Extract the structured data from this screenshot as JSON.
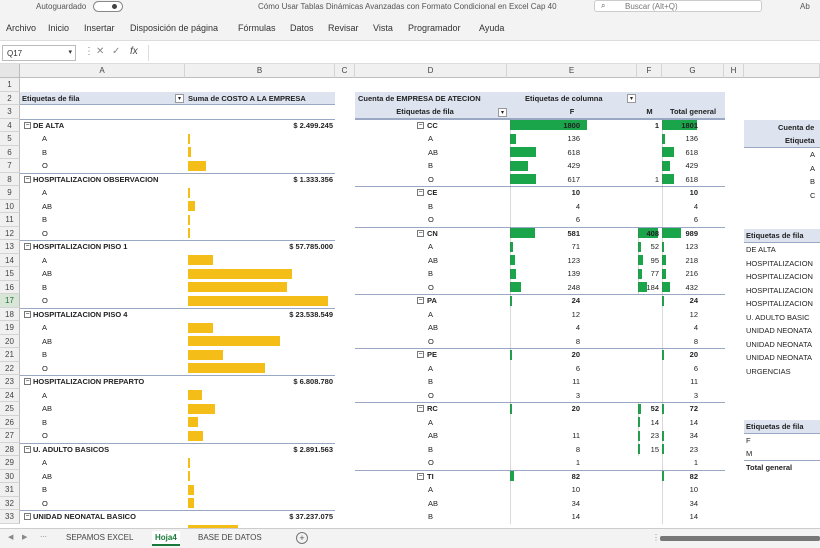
{
  "titlebar": {
    "autosave_label": "Autoguardado",
    "doc_title": "Cómo Usar Tablas Dinámicas Avanzadas con Formato Condicional en Excel Cap 40",
    "search_placeholder": "Buscar (Alt+Q)",
    "user": "Ab"
  },
  "menu": [
    "Archivo",
    "Inicio",
    "Insertar",
    "Disposición de página",
    "Fórmulas",
    "Datos",
    "Revisar",
    "Vista",
    "Programador",
    "Ayuda"
  ],
  "formula": {
    "namebox": "Q17",
    "fx": "fx",
    "content": ""
  },
  "columns": [
    "A",
    "B",
    "C",
    "D",
    "E",
    "F",
    "G",
    "H"
  ],
  "rows": [
    "1",
    "2",
    "3",
    "4",
    "5",
    "6",
    "7",
    "8",
    "9",
    "10",
    "11",
    "12",
    "13",
    "14",
    "15",
    "16",
    "17",
    "18",
    "19",
    "20",
    "21",
    "22",
    "23",
    "24",
    "25",
    "26",
    "27",
    "28",
    "29",
    "30",
    "31",
    "32",
    "33"
  ],
  "pivot1": {
    "header_rows": "Etiquetas de fila",
    "header_sum": "Suma de COSTO A LA EMPRESA",
    "rows": [
      {
        "label": "DE ALTA",
        "value": "$ 2.499.245",
        "group": true,
        "bar": 0
      },
      {
        "label": "A",
        "value": "",
        "group": false,
        "bar": 0.01
      },
      {
        "label": "B",
        "value": "",
        "group": false,
        "bar": 0.02
      },
      {
        "label": "O",
        "value": "",
        "group": false,
        "bar": 0.13
      },
      {
        "label": "HOSPITALIZACION OBSERVACION",
        "value": "$ 1.333.356",
        "group": true,
        "bar": 0
      },
      {
        "label": "A",
        "value": "",
        "group": false,
        "bar": 0.005
      },
      {
        "label": "AB",
        "value": "",
        "group": false,
        "bar": 0.05
      },
      {
        "label": "B",
        "value": "",
        "group": false,
        "bar": 0.005
      },
      {
        "label": "O",
        "value": "",
        "group": false,
        "bar": 0.005
      },
      {
        "label": "HOSPITALIZACION PISO 1",
        "value": "$ 57.785.000",
        "group": true,
        "bar": 0
      },
      {
        "label": "A",
        "value": "",
        "group": false,
        "bar": 0.18
      },
      {
        "label": "AB",
        "value": "",
        "group": false,
        "bar": 0.74
      },
      {
        "label": "B",
        "value": "",
        "group": false,
        "bar": 0.71
      },
      {
        "label": "O",
        "value": "",
        "group": false,
        "bar": 1.0
      },
      {
        "label": "HOSPITALIZACION PISO 4",
        "value": "$ 23.538.549",
        "group": true,
        "bar": 0
      },
      {
        "label": "A",
        "value": "",
        "group": false,
        "bar": 0.18
      },
      {
        "label": "AB",
        "value": "",
        "group": false,
        "bar": 0.66
      },
      {
        "label": "B",
        "value": "",
        "group": false,
        "bar": 0.25
      },
      {
        "label": "O",
        "value": "",
        "group": false,
        "bar": 0.55
      },
      {
        "label": "HOSPITALIZACION PREPARTO",
        "value": "$ 6.808.780",
        "group": true,
        "bar": 0
      },
      {
        "label": "A",
        "value": "",
        "group": false,
        "bar": 0.1
      },
      {
        "label": "AB",
        "value": "",
        "group": false,
        "bar": 0.19
      },
      {
        "label": "B",
        "value": "",
        "group": false,
        "bar": 0.07
      },
      {
        "label": "O",
        "value": "",
        "group": false,
        "bar": 0.11
      },
      {
        "label": "U. ADULTO BASICOS",
        "value": "$ 2.891.563",
        "group": true,
        "bar": 0
      },
      {
        "label": "A",
        "value": "",
        "group": false,
        "bar": 0.005
      },
      {
        "label": "AB",
        "value": "",
        "group": false,
        "bar": 0.005
      },
      {
        "label": "B",
        "value": "",
        "group": false,
        "bar": 0.04
      },
      {
        "label": "O",
        "value": "",
        "group": false,
        "bar": 0.04
      },
      {
        "label": "UNIDAD NEONATAL BASICO",
        "value": "$ 37.237.075",
        "group": true,
        "bar": 0
      },
      {
        "label": "A",
        "value": "",
        "group": false,
        "bar": 0.36
      }
    ]
  },
  "pivot2": {
    "title": "Cuenta de EMPRESA DE ATECION",
    "col_label": "Etiquetas de columna",
    "rows_label": "Etiquetas de fila",
    "col_f": "F",
    "col_m": "M",
    "col_total": "Total general",
    "rows": [
      {
        "label": "CC",
        "f": "1800",
        "m": "1",
        "t": "1801",
        "group": true,
        "fb": 1.0,
        "mb": 0,
        "tb": 1.0
      },
      {
        "label": "A",
        "f": "136",
        "m": "",
        "t": "136",
        "group": false,
        "fb": 0.08,
        "mb": 0,
        "tb": 0.08
      },
      {
        "label": "AB",
        "f": "618",
        "m": "",
        "t": "618",
        "group": false,
        "fb": 0.34,
        "mb": 0,
        "tb": 0.34
      },
      {
        "label": "B",
        "f": "429",
        "m": "",
        "t": "429",
        "group": false,
        "fb": 0.24,
        "mb": 0,
        "tb": 0.24
      },
      {
        "label": "O",
        "f": "617",
        "m": "1",
        "t": "618",
        "group": false,
        "fb": 0.34,
        "mb": 0,
        "tb": 0.34
      },
      {
        "label": "CE",
        "f": "10",
        "m": "",
        "t": "10",
        "group": true,
        "fb": 0,
        "mb": 0,
        "tb": 0
      },
      {
        "label": "B",
        "f": "4",
        "m": "",
        "t": "4",
        "group": false,
        "fb": 0,
        "mb": 0,
        "tb": 0
      },
      {
        "label": "O",
        "f": "6",
        "m": "",
        "t": "6",
        "group": false,
        "fb": 0,
        "mb": 0,
        "tb": 0
      },
      {
        "label": "CN",
        "f": "581",
        "m": "408",
        "t": "989",
        "group": true,
        "fb": 0.32,
        "mb": 1.0,
        "tb": 0.55
      },
      {
        "label": "A",
        "f": "71",
        "m": "52",
        "t": "123",
        "group": false,
        "fb": 0.04,
        "mb": 0.13,
        "tb": 0.07
      },
      {
        "label": "AB",
        "f": "123",
        "m": "95",
        "t": "218",
        "group": false,
        "fb": 0.07,
        "mb": 0.23,
        "tb": 0.12
      },
      {
        "label": "B",
        "f": "139",
        "m": "77",
        "t": "216",
        "group": false,
        "fb": 0.08,
        "mb": 0.19,
        "tb": 0.12
      },
      {
        "label": "O",
        "f": "248",
        "m": "184",
        "t": "432",
        "group": false,
        "fb": 0.14,
        "mb": 0.45,
        "tb": 0.24
      },
      {
        "label": "PA",
        "f": "24",
        "m": "",
        "t": "24",
        "group": true,
        "fb": 0.013,
        "mb": 0,
        "tb": 0.013
      },
      {
        "label": "A",
        "f": "12",
        "m": "",
        "t": "12",
        "group": false,
        "fb": 0,
        "mb": 0,
        "tb": 0
      },
      {
        "label": "AB",
        "f": "4",
        "m": "",
        "t": "4",
        "group": false,
        "fb": 0,
        "mb": 0,
        "tb": 0
      },
      {
        "label": "O",
        "f": "8",
        "m": "",
        "t": "8",
        "group": false,
        "fb": 0,
        "mb": 0,
        "tb": 0
      },
      {
        "label": "PE",
        "f": "20",
        "m": "",
        "t": "20",
        "group": true,
        "fb": 0.011,
        "mb": 0,
        "tb": 0.011
      },
      {
        "label": "A",
        "f": "6",
        "m": "",
        "t": "6",
        "group": false,
        "fb": 0,
        "mb": 0,
        "tb": 0
      },
      {
        "label": "B",
        "f": "11",
        "m": "",
        "t": "11",
        "group": false,
        "fb": 0,
        "mb": 0,
        "tb": 0
      },
      {
        "label": "O",
        "f": "3",
        "m": "",
        "t": "3",
        "group": false,
        "fb": 0,
        "mb": 0,
        "tb": 0
      },
      {
        "label": "RC",
        "f": "20",
        "m": "52",
        "t": "72",
        "group": true,
        "fb": 0.011,
        "mb": 0.13,
        "tb": 0.04
      },
      {
        "label": "A",
        "f": "",
        "m": "14",
        "t": "14",
        "group": false,
        "fb": 0,
        "mb": 0.03,
        "tb": 0
      },
      {
        "label": "AB",
        "f": "11",
        "m": "23",
        "t": "34",
        "group": false,
        "fb": 0,
        "mb": 0.05,
        "tb": 0.02
      },
      {
        "label": "B",
        "f": "8",
        "m": "15",
        "t": "23",
        "group": false,
        "fb": 0,
        "mb": 0.03,
        "tb": 0.01
      },
      {
        "label": "O",
        "f": "1",
        "m": "",
        "t": "1",
        "group": false,
        "fb": 0,
        "mb": 0,
        "tb": 0
      },
      {
        "label": "TI",
        "f": "82",
        "m": "",
        "t": "82",
        "group": true,
        "fb": 0.046,
        "mb": 0,
        "tb": 0.046
      },
      {
        "label": "A",
        "f": "10",
        "m": "",
        "t": "10",
        "group": false,
        "fb": 0,
        "mb": 0,
        "tb": 0
      },
      {
        "label": "AB",
        "f": "34",
        "m": "",
        "t": "34",
        "group": false,
        "fb": 0,
        "mb": 0,
        "tb": 0
      },
      {
        "label": "B",
        "f": "14",
        "m": "",
        "t": "14",
        "group": false,
        "fb": 0,
        "mb": 0,
        "tb": 0
      }
    ]
  },
  "pivot3": {
    "cuenta": "Cuenta de",
    "etiq": "Etiqueta",
    "letters": [
      "A",
      "A",
      "B",
      "C"
    ]
  },
  "pivot4": {
    "header": "Etiquetas de fila",
    "items": [
      "DE ALTA",
      "HOSPITALIZACION",
      "HOSPITALIZACION",
      "HOSPITALIZACION",
      "HOSPITALIZACION",
      "U. ADULTO BASIC",
      "UNIDAD NEONATA",
      "UNIDAD NEONATA",
      "UNIDAD NEONATA",
      "URGENCIAS"
    ]
  },
  "pivot5": {
    "header": "Etiquetas de fila",
    "items": [
      "F",
      "M"
    ],
    "total": "Total general"
  },
  "sheets": [
    {
      "label": "SEPAMOS EXCEL",
      "active": false
    },
    {
      "label": "Hoja4",
      "active": true
    },
    {
      "label": "BASE DE DATOS",
      "active": false
    }
  ],
  "colors": {
    "yellow_bar": "#f4bd18",
    "green_bar": "#1aa54a",
    "pivot_header": "#dde4f0"
  }
}
